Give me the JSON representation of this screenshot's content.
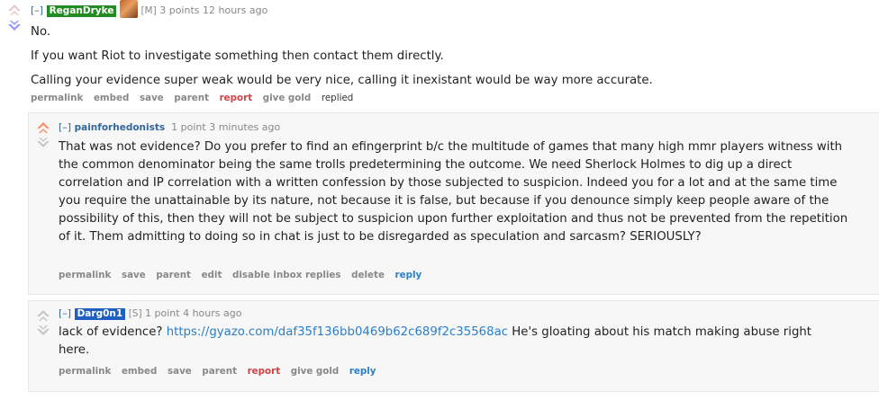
{
  "comments": [
    {
      "toggle": "[–]",
      "author": "ReganDryke",
      "author_color": "#228b22",
      "flair": "[M]",
      "meta": "3 points 12 hours ago",
      "body": [
        "No.",
        "If you want Riot to investigate something then contact them directly.",
        "Calling your evidence super weak would be very nice, calling it inexistant would be way more accurate."
      ],
      "buttons": [
        "permalink",
        "embed",
        "save",
        "parent",
        "report",
        "give gold",
        "replied"
      ]
    },
    {
      "toggle": "[–]",
      "author": "painforhedonists",
      "meta": "1 point 3 minutes ago",
      "body": [
        "That was not evidence? Do you prefer to find an efingerprint b/c the multitude of games that many high mmr players witness with the common denominator being the same trolls predetermining the outcome. We need Sherlock Holmes to dig up a direct correlation and IP correlation with a written confession by those subjected to suspicion. Indeed you for a lot and at the same time you require the unattainable by its nature, not because it is false, but because if you denounce simply keep people aware of the possibility of this, then they will not be subject to suspicion upon further exploitation and thus not be prevented from the repetition of it. Them admitting to doing so in chat is just to be disregarded as speculation and sarcasm? SERIOUSLY?"
      ],
      "buttons": [
        "permalink",
        "save",
        "parent",
        "edit",
        "disable inbox replies",
        "delete",
        "reply"
      ]
    },
    {
      "toggle": "[–]",
      "author": "Darg0n1",
      "author_color": "#1e5fbf",
      "flair": "[S]",
      "meta": "1 point 4 hours ago",
      "body_prefix": "lack of evidence?",
      "body_link": "https://gyazo.com/daf35f136bb0469b62c689f2c35568ac",
      "body_suffix": "He's gloating about his match making abuse right here.",
      "buttons": [
        "permalink",
        "embed",
        "save",
        "parent",
        "report",
        "give gold",
        "reply"
      ]
    }
  ],
  "colors": {
    "upvote_active": "#ff8b60",
    "downvote_active": "#9494ff",
    "vote_inactive": "#c6c6c6"
  }
}
